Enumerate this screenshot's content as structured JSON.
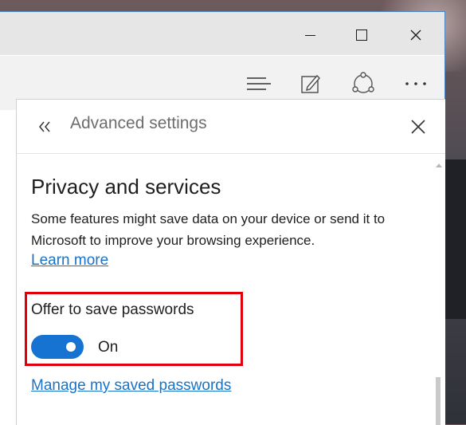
{
  "pane": {
    "title": "Advanced settings",
    "section_title": "Privacy and services",
    "description": "Some features might save data on your device or send it to Microsoft to improve your browsing experience.",
    "learn_more": "Learn more",
    "offer_passwords_label": "Offer to save passwords",
    "toggle_state": "On",
    "toggle_on": true,
    "manage_passwords_link": "Manage my saved passwords"
  },
  "icons": {
    "minimize": "minimize-icon",
    "maximize": "maximize-icon",
    "close": "close-icon",
    "hub": "hub-icon",
    "web_note": "web-note-icon",
    "share": "share-icon",
    "more": "more-icon",
    "back": "double-chevron-left-icon",
    "pane_close": "close-icon"
  },
  "colors": {
    "accent": "#1673d2",
    "link": "#1a73c8",
    "highlight_box": "#e0000b"
  }
}
